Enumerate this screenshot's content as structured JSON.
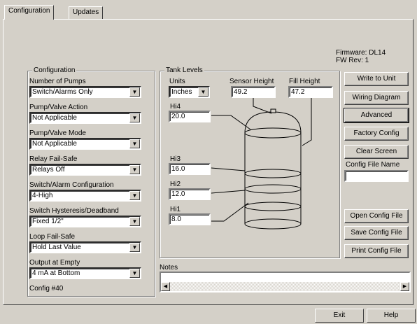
{
  "tabs": [
    {
      "label": "Configuration"
    },
    {
      "label": "Updates"
    }
  ],
  "firmware": {
    "version": "Firmware: DL14",
    "rev": "FW Rev: 1"
  },
  "config_group": {
    "title": "Configuration",
    "fields": [
      {
        "label": "Number of Pumps",
        "value": "Switch/Alarms Only"
      },
      {
        "label": "Pump/Valve Action",
        "value": "Not Applicable"
      },
      {
        "label": "Pump/Valve Mode",
        "value": "Not Applicable"
      },
      {
        "label": "Relay Fail-Safe",
        "value": "Relays Off"
      },
      {
        "label": "Switch/Alarm Configuration",
        "value": "4-High"
      },
      {
        "label": "Switch Hysteresis/Deadband",
        "value": "Fixed 1/2\""
      },
      {
        "label": "Loop Fail-Safe",
        "value": "Hold Last Value"
      },
      {
        "label": "Output at Empty",
        "value": "4 mA at Bottom"
      }
    ],
    "footer": "Config #40"
  },
  "tank_group": {
    "title": "Tank Levels",
    "units_label": "Units",
    "units_value": "Inches",
    "sensor_height_label": "Sensor Height",
    "sensor_height_value": "49.2",
    "fill_height_label": "Fill Height",
    "fill_height_value": "47.2",
    "levels": [
      {
        "label": "Hi4",
        "value": "20.0"
      },
      {
        "label": "Hi3",
        "value": "16.0"
      },
      {
        "label": "Hi2",
        "value": "12.0"
      },
      {
        "label": "Hi1",
        "value": "8.0"
      }
    ]
  },
  "buttons": {
    "write": "Write to Unit",
    "wiring": "Wiring Diagram",
    "advanced": "Advanced",
    "factory": "Factory Config",
    "clear": "Clear Screen",
    "open": "Open Config File",
    "save": "Save Config File",
    "print": "Print Config File"
  },
  "config_file_label": "Config File Name",
  "config_file_value": "",
  "notes_label": "Notes",
  "status": {
    "exit": "Exit",
    "help": "Help"
  }
}
